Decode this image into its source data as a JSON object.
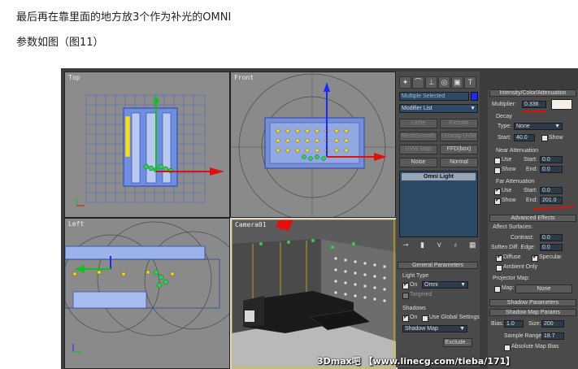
{
  "article": {
    "line1": "最后再在靠里面的地方放3个作为补光的OMNI",
    "line2": "参数如图（图11）"
  },
  "viewports": {
    "top": "Top",
    "front": "Front",
    "left": "Left",
    "camera": "Camera01"
  },
  "command_panel": {
    "tab_icons": [
      "create-icon",
      "modify-icon",
      "hierarchy-icon",
      "motion-icon",
      "display-icon",
      "utilities-icon"
    ],
    "selection_name": "Multiple Selected",
    "modifier_list": "Modifier List",
    "buttons": [
      "Lathe",
      "Extrude",
      "MeshSmooth",
      "Unwrap UVW",
      "UVW Map",
      "FFD(box)",
      "Noise",
      "Normal"
    ],
    "stack_item": "Omni Light",
    "general_parameters": {
      "title": "General Parameters",
      "light_type_label": "Light Type",
      "on_label": "On",
      "type_value": "Omni",
      "targeted_label": "Targeted",
      "shadows_label": "Shadows",
      "shadows_on_label": "On",
      "use_global_label": "Use Global Settings",
      "shadow_type": "Shadow Map",
      "exclude_button": "Exclude..."
    }
  },
  "properties": {
    "intensity_title": "Intensity/Color/Attenuation",
    "multiplier_label": "Multiplier:",
    "multiplier_value": "0.336",
    "decay_label": "Decay",
    "type_label": "Type:",
    "type_value": "None",
    "start_label": "Start:",
    "decay_start": "40.0",
    "show_label": "Show",
    "near_title": "Near Attenuation",
    "use_label": "Use",
    "near_start": "0.0",
    "end_label": "End:",
    "near_end": "0.0",
    "far_title": "Far Attenuation",
    "far_start": "0.0",
    "far_end": "201.0",
    "advanced_title": "Advanced Effects",
    "affect_surfaces": "Affect Surfaces:",
    "contrast_label": "Contrast:",
    "contrast_value": "0.0",
    "soften_label": "Soften Diff. Edge:",
    "soften_value": "0.0",
    "diffuse_label": "Diffuse",
    "specular_label": "Specular",
    "ambient_label": "Ambient Only",
    "projector_label": "Projector Map:",
    "map_label": "Map:",
    "map_value": "None",
    "shadow_params_title": "Shadow Parameters",
    "shadow_map_title": "Shadow Map Params",
    "bias_label": "Bias:",
    "bias_value": "1.0",
    "size_label": "Size:",
    "size_value": "200",
    "sample_label": "Sample Range:",
    "sample_value": "18.7",
    "absolute_label": "Absolute Map Bias"
  },
  "watermark": "3Dmax吧 【www.linecg.com/tieba/171】",
  "colors": {
    "highlight_red": "#e01010",
    "axis_blue": "#1a2aff",
    "axis_green": "#10c020",
    "light_yellow": "#f2e020"
  }
}
